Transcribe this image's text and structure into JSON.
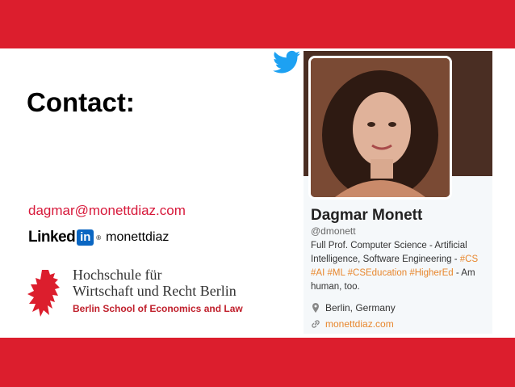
{
  "slide": {
    "title": "Contact:",
    "email": "dagmar@monettdiaz.com",
    "linkedin": {
      "word": "Linked",
      "box": "in",
      "reg": "®",
      "handle": "monettdiaz"
    },
    "school": {
      "line1": "Hochschule für",
      "line2": "Wirtschaft und Recht Berlin",
      "line3": "Berlin School of Economics and Law"
    }
  },
  "twitter_card": {
    "name": "Dagmar Monett",
    "handle": "@dmonett",
    "bio_parts": {
      "p1": "Full Prof. Computer Science - Artificial Intelligence, Software Engineering - ",
      "t1": "#CS",
      "t2": "#AI",
      "t3": "#ML",
      "t4": "#CSEducation",
      "t5": "#HigherEd",
      "p2": " - Am human, too."
    },
    "location": "Berlin, Germany",
    "website": "monettdiaz.com"
  },
  "colors": {
    "band": "#dc1e2d",
    "email": "#d7183a",
    "hashtag": "#e8862c",
    "linkedin_blue": "#0a66c2",
    "twitter_blue": "#1da1f2"
  },
  "icons": [
    "twitter-bird-icon",
    "linkedin-logo-icon",
    "berlin-bear-icon",
    "location-pin-icon",
    "link-icon"
  ]
}
